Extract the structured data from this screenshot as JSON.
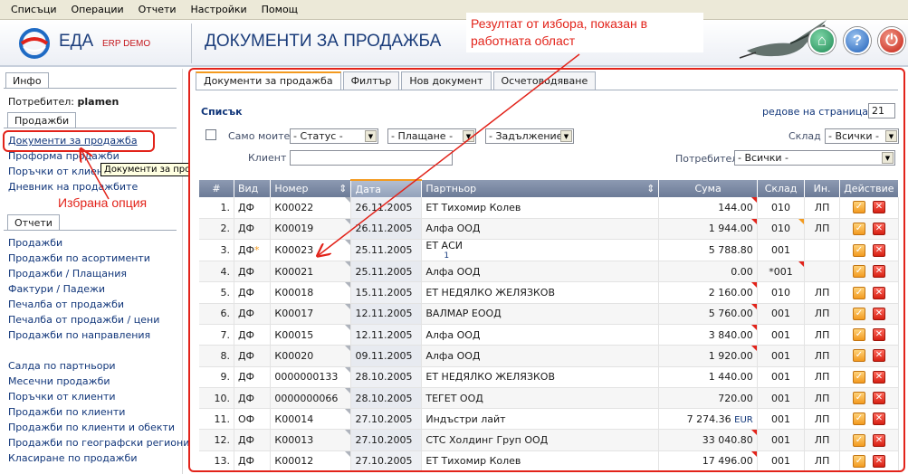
{
  "menubar": [
    "Списъци",
    "Операции",
    "Отчети",
    "Настройки",
    "Помощ"
  ],
  "header": {
    "logo": "ЕДА",
    "logo_sub": "ERP DEMO",
    "page_title": "ДОКУМЕНТИ ЗА ПРОДАЖБА",
    "callout": "Резултат от избора, показан в работната област"
  },
  "sidebar": {
    "tab_info": "Инфо",
    "user_label": "Потребител:",
    "user_name": "plamen",
    "tab_sales": "Продажби",
    "sales_links": [
      "Документи за продажба",
      "Проформа продажби",
      "Поръчки от клиенти",
      "Дневник на продажбите"
    ],
    "tooltip": "Документи за продажба",
    "annotation": "Избрана опция",
    "tab_reports": "Отчети",
    "reports_group1": [
      "Продажби",
      "Продажби по асортименти",
      "Продажби / Плащания",
      "Фактури / Падежи",
      "Печалба от продажби",
      "Печалба от продажби / цени",
      "Продажби по направления"
    ],
    "reports_group2": [
      "Салда по партньори",
      "Месечни продажби",
      "Поръчки от клиенти",
      "Продажби по клиенти",
      "Продажби по клиенти и обекти",
      "Продажби по географски региони",
      "Класиране по продажби"
    ]
  },
  "main": {
    "tabs": [
      "Документи за продажба",
      "Филтър",
      "Нов документ",
      "Осчетоводяване"
    ],
    "list_title": "Списък",
    "per_page_label": "редове на страница",
    "per_page_value": "21",
    "filters": {
      "only_mine": "Само моите",
      "status": "- Статус -",
      "payment": "- Плащане -",
      "debt": "- Задължение -",
      "warehouse_label": "Склад",
      "warehouse": "- Всички -",
      "client_label": "Клиент",
      "user_label": "Потребител",
      "user": "- Всички -"
    },
    "columns": [
      "#",
      "Вид",
      "Номер",
      "Дата",
      "Партньор",
      "Сума",
      "Склад",
      "Ин.",
      "Действие"
    ],
    "rows": [
      {
        "n": "1.",
        "type": "ДФ",
        "num": "К00022",
        "date": "26.11.2005",
        "partner": "ЕТ Тихомир Колев",
        "sum": "144.00",
        "wh": "010",
        "in": "ЛП"
      },
      {
        "n": "2.",
        "type": "ДФ",
        "num": "К00019",
        "date": "26.11.2005",
        "partner": "Алфа ООД",
        "sum": "1 944.00",
        "wh": "010",
        "in": "ЛП"
      },
      {
        "n": "3.",
        "type": "ДФ",
        "star": "*",
        "num": "К00023",
        "date": "25.11.2005",
        "partner": "ЕТ АСИ",
        "partner_sub": "1",
        "sum": "5 788.80",
        "wh": "001",
        "in": ""
      },
      {
        "n": "4.",
        "type": "ДФ",
        "num": "К00021",
        "date": "25.11.2005",
        "partner": "Алфа ООД",
        "sum": "0.00",
        "wh": "*001",
        "in": ""
      },
      {
        "n": "5.",
        "type": "ДФ",
        "num": "К00018",
        "date": "15.11.2005",
        "partner": "ЕТ НЕДЯЛКО ЖЕЛЯЗКОВ",
        "sum": "2 160.00",
        "wh": "010",
        "in": "ЛП"
      },
      {
        "n": "6.",
        "type": "ДФ",
        "num": "К00017",
        "date": "12.11.2005",
        "partner": "ВАЛМАР ЕООД",
        "sum": "5 760.00",
        "wh": "001",
        "in": "ЛП"
      },
      {
        "n": "7.",
        "type": "ДФ",
        "num": "К00015",
        "date": "12.11.2005",
        "partner": "Алфа ООД",
        "sum": "3 840.00",
        "wh": "001",
        "in": "ЛП"
      },
      {
        "n": "8.",
        "type": "ДФ",
        "num": "К00020",
        "date": "09.11.2005",
        "partner": "Алфа ООД",
        "sum": "1 920.00",
        "wh": "001",
        "in": "ЛП"
      },
      {
        "n": "9.",
        "type": "ДФ",
        "num": "0000000133",
        "date": "28.10.2005",
        "partner": "ЕТ НЕДЯЛКО ЖЕЛЯЗКОВ",
        "sum": "1 440.00",
        "wh": "001",
        "in": "ЛП"
      },
      {
        "n": "10.",
        "type": "ДФ",
        "num": "0000000066",
        "date": "28.10.2005",
        "partner": "ТЕГЕТ ООД",
        "sum": "720.00",
        "wh": "001",
        "in": "ЛП"
      },
      {
        "n": "11.",
        "type": "ОФ",
        "num": "К00014",
        "date": "27.10.2005",
        "partner": "Индъстри лайт",
        "sum": "7 274.36",
        "currency": "EUR",
        "wh": "001",
        "in": "ЛП"
      },
      {
        "n": "12.",
        "type": "ДФ",
        "num": "К00013",
        "date": "27.10.2005",
        "partner": "СТС Холдинг Груп ООД",
        "sum": "33 040.80",
        "wh": "001",
        "in": "ЛП"
      },
      {
        "n": "13.",
        "type": "ДФ",
        "num": "К00012",
        "date": "27.10.2005",
        "partner": "ЕТ Тихомир Колев",
        "sum": "17 496.00",
        "wh": "001",
        "in": "ЛП"
      }
    ]
  },
  "colors": {
    "accent": "#e2231a",
    "brand": "#1a3c7a",
    "orange": "#f39a1f"
  },
  "icons": [
    "logo-icon",
    "bird-icon",
    "home-icon",
    "help-icon",
    "power-icon",
    "edit-icon",
    "delete-icon",
    "sort-icon",
    "dropdown-arrow-icon"
  ]
}
